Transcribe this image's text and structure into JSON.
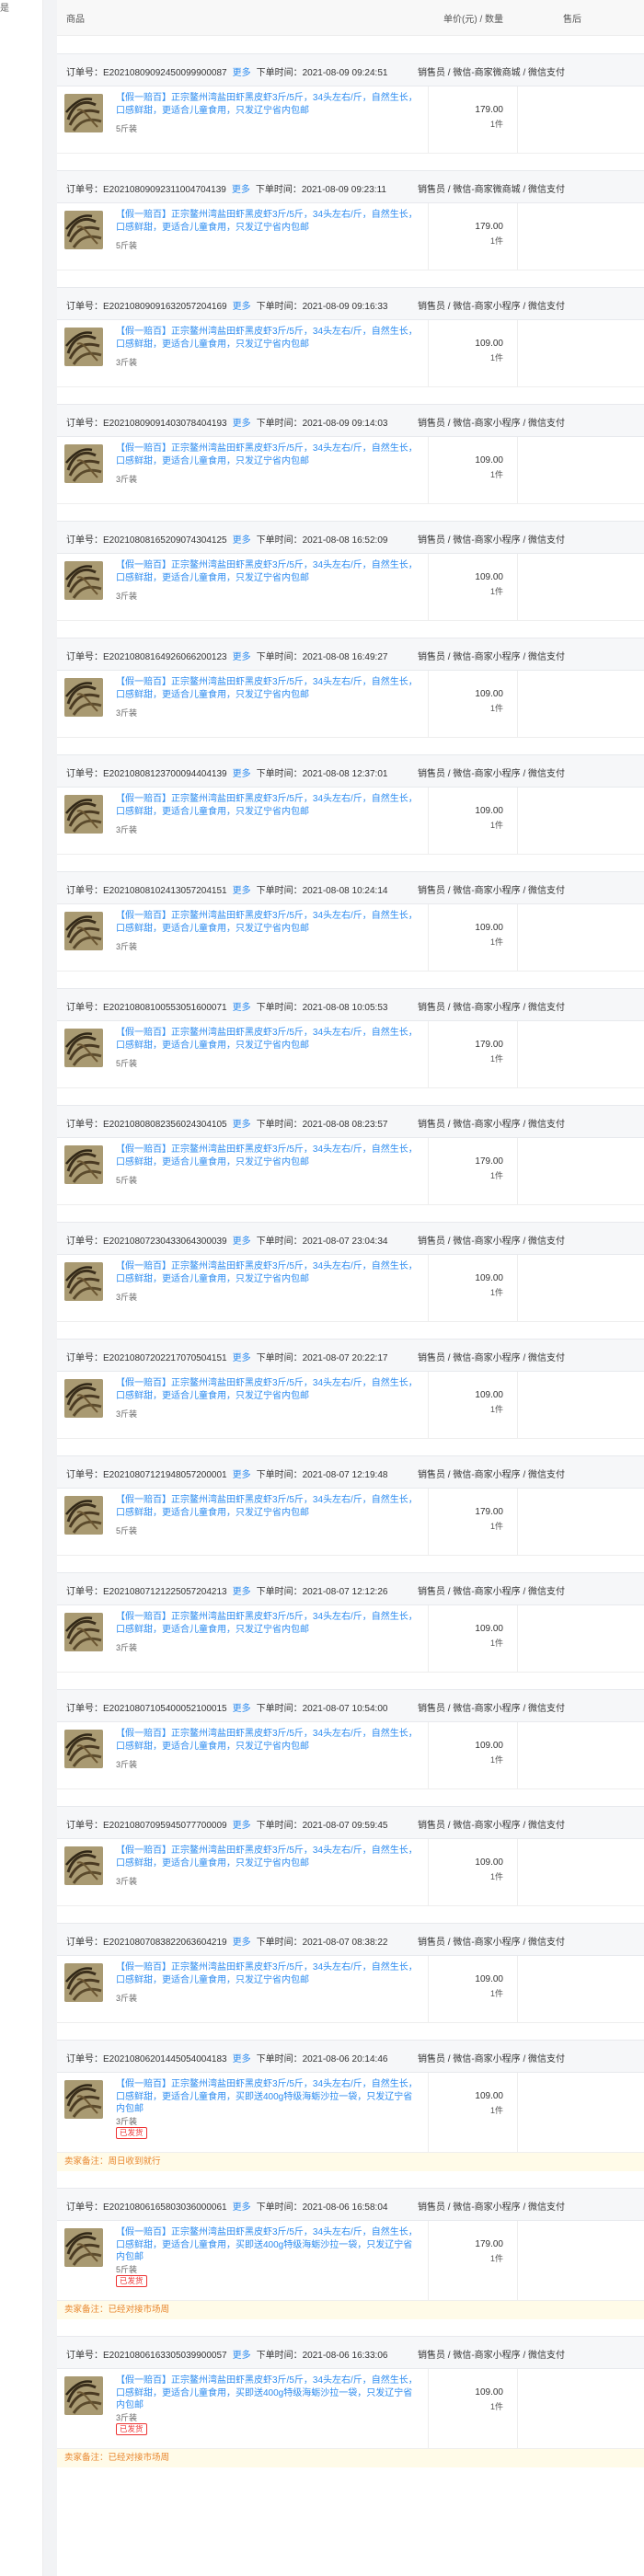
{
  "sidebar": {
    "mark": "是"
  },
  "table_header": {
    "product": "商品",
    "price_qty": "单价(元) / 数量",
    "after_sale": "售后"
  },
  "labels": {
    "order_no_prefix": "订单号：",
    "more": "更多",
    "time_prefix": "下单时间："
  },
  "product": {
    "title_a": "【假一赔百】正宗鳌州湾盐田虾黑皮虾3斤/5斤，34头左右/斤，自然生长，口感鲜甜，更适合儿童食用，只发辽宁省内包邮",
    "title_b": "【假一赔百】正宗鳌州湾盐田虾黑皮虾3斤/5斤，34头左右/斤，自然生长，口感鲜甜，更适合儿童食用，买即送400g特级海蛎沙拉一袋，只发辽宁省内包邮"
  },
  "orders": [
    {
      "order_no": "E20210809092450099900087",
      "time": "2021-08-09 09:24:51",
      "seller": "销售员 / 微信-商家微商城 / 微信支付",
      "price": "179.00",
      "qty": "1件",
      "spec": "5斤装"
    },
    {
      "order_no": "E20210809092311004704139",
      "time": "2021-08-09 09:23:11",
      "seller": "销售员 / 微信-商家微商城 / 微信支付",
      "price": "179.00",
      "qty": "1件",
      "spec": "5斤装"
    },
    {
      "order_no": "E20210809091632057204169",
      "time": "2021-08-09 09:16:33",
      "seller": "销售员 / 微信-商家小程序 / 微信支付",
      "price": "109.00",
      "qty": "1件",
      "spec": "3斤装"
    },
    {
      "order_no": "E20210809091403078404193",
      "time": "2021-08-09 09:14:03",
      "seller": "销售员 / 微信-商家小程序 / 微信支付",
      "price": "109.00",
      "qty": "1件",
      "spec": "3斤装"
    },
    {
      "order_no": "E20210808165209074304125",
      "time": "2021-08-08 16:52:09",
      "seller": "销售员 / 微信-商家小程序 / 微信支付",
      "price": "109.00",
      "qty": "1件",
      "spec": "3斤装"
    },
    {
      "order_no": "E20210808164926066200123",
      "time": "2021-08-08 16:49:27",
      "seller": "销售员 / 微信-商家小程序 / 微信支付",
      "price": "109.00",
      "qty": "1件",
      "spec": "3斤装"
    },
    {
      "order_no": "E20210808123700094404139",
      "time": "2021-08-08 12:37:01",
      "seller": "销售员 / 微信-商家小程序 / 微信支付",
      "price": "109.00",
      "qty": "1件",
      "spec": "3斤装"
    },
    {
      "order_no": "E20210808102413057204151",
      "time": "2021-08-08 10:24:14",
      "seller": "销售员 / 微信-商家小程序 / 微信支付",
      "price": "109.00",
      "qty": "1件",
      "spec": "3斤装"
    },
    {
      "order_no": "E20210808100553051600071",
      "time": "2021-08-08 10:05:53",
      "seller": "销售员 / 微信-商家小程序 / 微信支付",
      "price": "179.00",
      "qty": "1件",
      "spec": "5斤装"
    },
    {
      "order_no": "E20210808082356024304105",
      "time": "2021-08-08 08:23:57",
      "seller": "销售员 / 微信-商家小程序 / 微信支付",
      "price": "179.00",
      "qty": "1件",
      "spec": "5斤装"
    },
    {
      "order_no": "E20210807230433064300039",
      "time": "2021-08-07 23:04:34",
      "seller": "销售员 / 微信-商家小程序 / 微信支付",
      "price": "109.00",
      "qty": "1件",
      "spec": "3斤装"
    },
    {
      "order_no": "E20210807202217070504151",
      "time": "2021-08-07 20:22:17",
      "seller": "销售员 / 微信-商家小程序 / 微信支付",
      "price": "109.00",
      "qty": "1件",
      "spec": "3斤装"
    },
    {
      "order_no": "E20210807121948057200001",
      "time": "2021-08-07 12:19:48",
      "seller": "销售员 / 微信-商家小程序 / 微信支付",
      "price": "179.00",
      "qty": "1件",
      "spec": "5斤装"
    },
    {
      "order_no": "E20210807121225057204213",
      "time": "2021-08-07 12:12:26",
      "seller": "销售员 / 微信-商家小程序 / 微信支付",
      "price": "109.00",
      "qty": "1件",
      "spec": "3斤装"
    },
    {
      "order_no": "E20210807105400052100015",
      "time": "2021-08-07 10:54:00",
      "seller": "销售员 / 微信-商家小程序 / 微信支付",
      "price": "109.00",
      "qty": "1件",
      "spec": "3斤装"
    },
    {
      "order_no": "E20210807095945077700009",
      "time": "2021-08-07 09:59:45",
      "seller": "销售员 / 微信-商家小程序 / 微信支付",
      "price": "109.00",
      "qty": "1件",
      "spec": "3斤装"
    },
    {
      "order_no": "E20210807083822063604219",
      "time": "2021-08-07 08:38:22",
      "seller": "销售员 / 微信-商家小程序 / 微信支付",
      "price": "109.00",
      "qty": "1件",
      "spec": "3斤装"
    },
    {
      "order_no": "E20210806201445054004183",
      "time": "2021-08-06 20:14:46",
      "seller": "销售员 / 微信-商家小程序 / 微信支付",
      "price": "109.00",
      "qty": "1件",
      "spec": "3斤装",
      "tag": "已发货",
      "remark": "卖家备注：周日收到就行"
    },
    {
      "order_no": "E20210806165803036000061",
      "time": "2021-08-06 16:58:04",
      "seller": "销售员 / 微信-商家小程序 / 微信支付",
      "price": "179.00",
      "qty": "1件",
      "spec": "5斤装",
      "tag": "已发货",
      "remark": "卖家备注：已经对接市场周"
    },
    {
      "order_no": "E20210806163305039900057",
      "time": "2021-08-06 16:33:06",
      "seller": "销售员 / 微信-商家小程序 / 微信支付",
      "price": "109.00",
      "qty": "1件",
      "spec": "3斤装",
      "tag": "已发货",
      "remark": "卖家备注：已经对接市场周"
    }
  ]
}
